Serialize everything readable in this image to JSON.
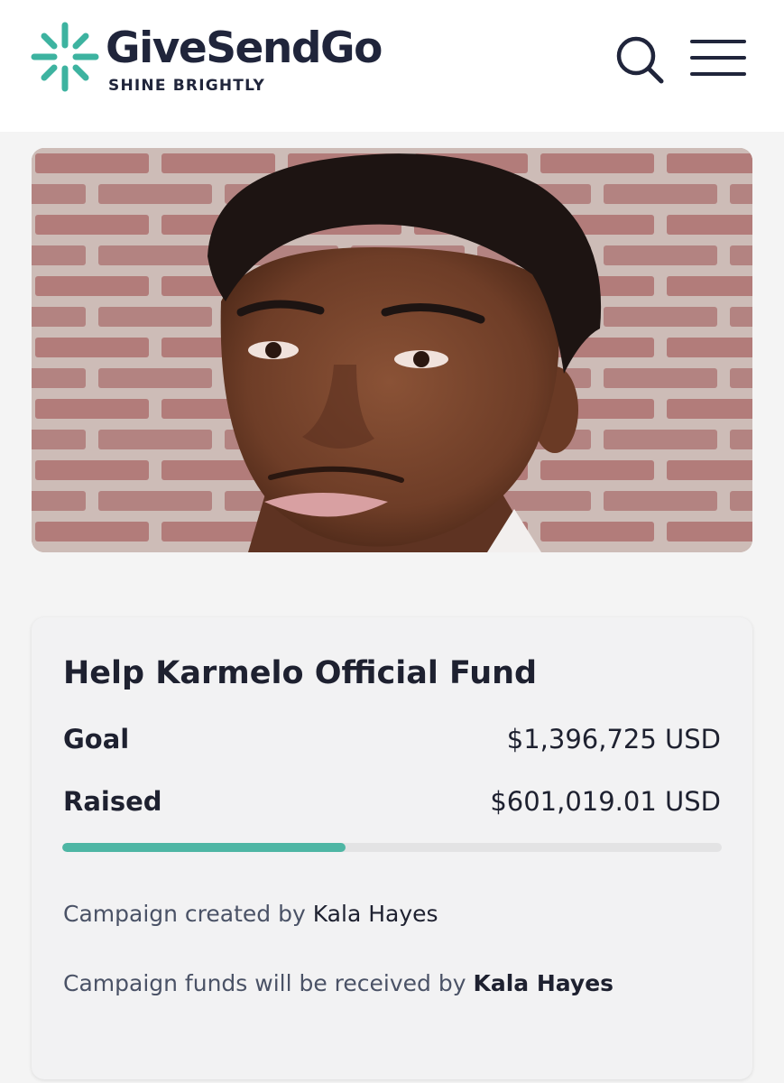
{
  "header": {
    "brand_name": "GiveSendGo",
    "tagline": "SHINE BRIGHTLY",
    "logo_icon": "sparkle-logo-icon",
    "search_icon": "search-icon",
    "menu_icon": "hamburger-menu-icon",
    "accent_color": "#3db3a0",
    "brand_color": "#20253b"
  },
  "campaign": {
    "title": "Help Karmelo Official Fund",
    "goal_label": "Goal",
    "goal_value": "$1,396,725 USD",
    "raised_label": "Raised",
    "raised_value": "$601,019.01 USD",
    "progress_fraction": 0.43,
    "progress_color": "#4eb6a4",
    "created_by_prefix": "Campaign created by",
    "created_by_name": "Kala Hayes",
    "received_by_prefix": "Campaign funds will be received by",
    "received_by_name": "Kala Hayes"
  }
}
